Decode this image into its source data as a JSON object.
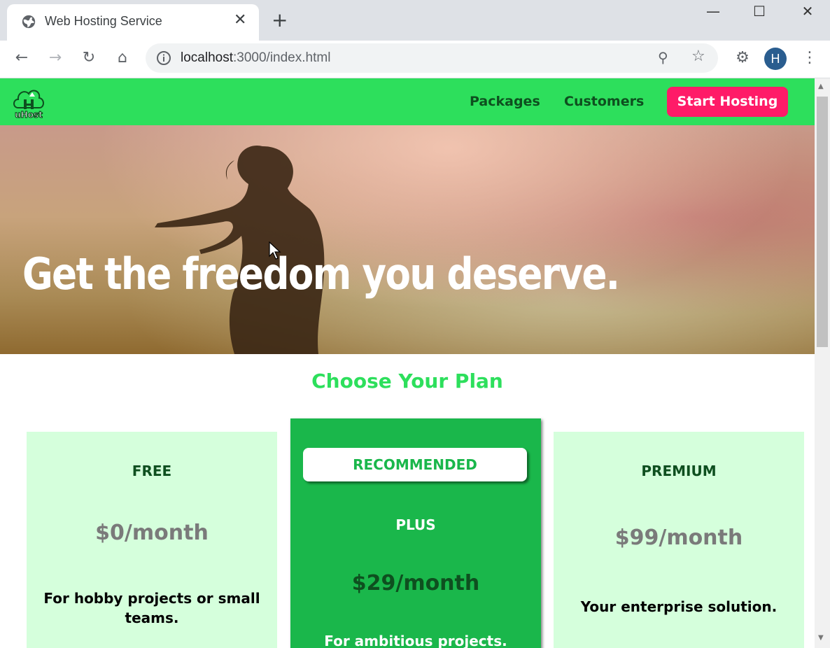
{
  "browser": {
    "tab_title": "Web Hosting Service",
    "tab_close": "✕",
    "new_tab": "+",
    "url_host": "localhost",
    "url_rest": ":3000/index.html",
    "avatar_letter": "H",
    "window_controls": {
      "minimize": "—",
      "maximize": "☐",
      "close": "✕"
    }
  },
  "site": {
    "logo_text": "uHost",
    "nav": {
      "packages": "Packages",
      "customers": "Customers",
      "cta": "Start Hosting"
    },
    "hero_title": "Get the freedom you deserve.",
    "plans_heading": "Choose Your Plan",
    "plans": [
      {
        "name": "FREE",
        "price": "$0/month",
        "description": "For hobby projects or small teams."
      },
      {
        "badge": "RECOMMENDED",
        "name": "PLUS",
        "price": "$29/month",
        "description": "For ambitious projects."
      },
      {
        "name": "PREMIUM",
        "price": "$99/month",
        "description": "Your enterprise solution."
      }
    ]
  },
  "colors": {
    "header_green": "#2ddf5c",
    "featured_green": "#1ab74b",
    "plan_bg": "#d5ffdc",
    "cta_pink": "#ff1b68",
    "dark_green_text": "#0e4f1f"
  }
}
